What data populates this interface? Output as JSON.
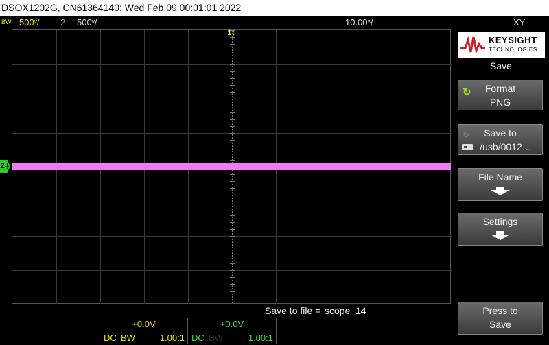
{
  "title_bar": "DSOX1202G, CN61364140: Wed Feb 09 00:01:01 2022",
  "status": {
    "bw_tag": "BW",
    "ch1_scale": "500ᵛ/",
    "ch2_number": "2",
    "ch2_scale": "500ᵛ/",
    "timebase": "10.00ˢ/",
    "mode": "XY"
  },
  "markers": {
    "ch2": "2",
    "trigger": "1"
  },
  "logo": {
    "name": "KEYSIGHT",
    "subtitle": "TECHNOLOGIES"
  },
  "menu": {
    "title": "Save",
    "softkeys": [
      {
        "line1": "Format",
        "line2": "PNG"
      },
      {
        "line1": "Save to",
        "line2": "/usb/0012…"
      },
      {
        "line1": "File Name"
      },
      {
        "line1": "Settings"
      },
      {
        "line1": "Press to",
        "line2": "Save"
      }
    ]
  },
  "message": {
    "label": "Save to file =",
    "value": "scope_14"
  },
  "channels": [
    {
      "offset": "+0.0V",
      "coupling": "DC",
      "bw": "BW",
      "probe": "1.00:1"
    },
    {
      "offset": "+0.0V",
      "coupling": "DC",
      "bw": "BW",
      "probe": "1.00:1"
    }
  ],
  "colors": {
    "ch1": "#e8e000",
    "ch2": "#3adc3a",
    "trace": "#f07af0",
    "accent": "#9ee41a",
    "logo_red": "#d21e2b"
  },
  "icons": {
    "refresh": "refresh-icon",
    "usb": "usb-icon",
    "down_arrow": "arrow-down-icon"
  }
}
